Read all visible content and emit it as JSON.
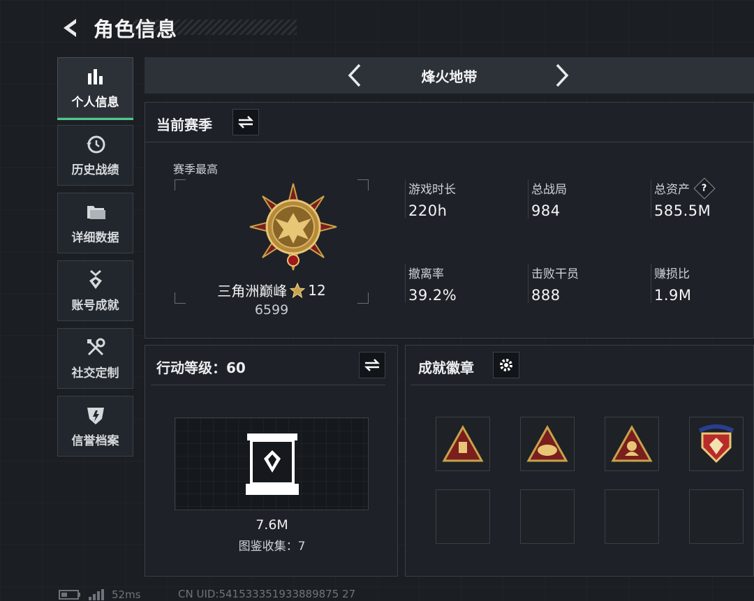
{
  "header": {
    "title": "角色信息"
  },
  "sidebar": {
    "items": [
      {
        "label": "个人信息",
        "icon": "bar-chart-icon",
        "active": true
      },
      {
        "label": "历史战绩",
        "icon": "history-icon"
      },
      {
        "label": "详细数据",
        "icon": "folder-icon"
      },
      {
        "label": "账号成就",
        "icon": "medal-icon"
      },
      {
        "label": "社交定制",
        "icon": "tools-icon"
      },
      {
        "label": "信誉档案",
        "icon": "shield-icon"
      }
    ]
  },
  "mode_bar": {
    "title": "烽火地带"
  },
  "season": {
    "title": "当前赛季",
    "best_label": "赛季最高",
    "rank_name": "三角洲巅峰",
    "rank_stars": "12",
    "rank_score": "6599",
    "stats": [
      {
        "label": "游戏时长",
        "value": "220h"
      },
      {
        "label": "总战局",
        "value": "984"
      },
      {
        "label": "总资产",
        "value": "585.5M",
        "help": "?"
      },
      {
        "label": "撤离率",
        "value": "39.2%"
      },
      {
        "label": "击败干员",
        "value": "888"
      },
      {
        "label": "赚损比",
        "value": "1.9M"
      }
    ]
  },
  "level": {
    "title": "行动等级：60",
    "collection_value": "7.6M",
    "collection_count": "图鉴收集：7"
  },
  "badges": {
    "title": "成就徽章"
  },
  "footer": {
    "ping": "52ms",
    "uid": "CN UID:541533351933889875 27"
  },
  "colors": {
    "accent": "#4fc98a",
    "gold": "#c9a24a",
    "badge_red": "#7a1e1e"
  }
}
